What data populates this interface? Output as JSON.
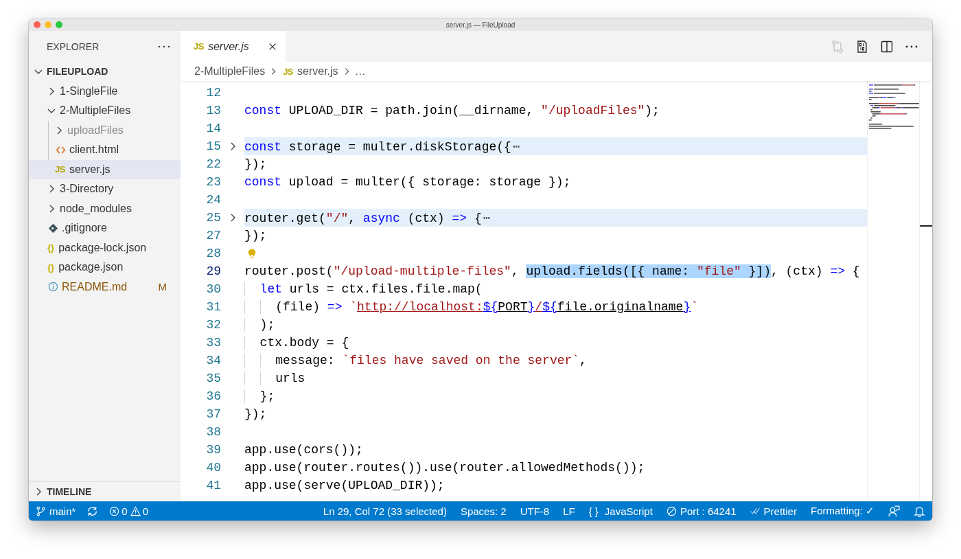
{
  "window": {
    "title": "server.js — FileUpload"
  },
  "sidebar": {
    "title": "EXPLORER",
    "root": {
      "label": "FILEUPLOAD",
      "kind": "folder",
      "expanded": true,
      "children": [
        {
          "label": "1-SingleFile",
          "kind": "folder",
          "expanded": false,
          "selected": false
        },
        {
          "label": "2-MultipleFiles",
          "kind": "folder",
          "expanded": true,
          "selected": false,
          "children": [
            {
              "label": "uploadFiles",
              "kind": "folder",
              "expanded": false,
              "selected": false,
              "dimmed": true
            },
            {
              "label": "client.html",
              "kind": "html",
              "selected": false
            },
            {
              "label": "server.js",
              "kind": "js",
              "icon": "JS",
              "selected": true
            }
          ]
        },
        {
          "label": "3-Directory",
          "kind": "folder",
          "expanded": false,
          "selected": false
        },
        {
          "label": "node_modules",
          "kind": "folder",
          "expanded": false,
          "selected": false
        },
        {
          "label": ".gitignore",
          "kind": "git",
          "selected": false
        },
        {
          "label": "package-lock.json",
          "kind": "json",
          "icon": "{}",
          "selected": false
        },
        {
          "label": "package.json",
          "kind": "json",
          "icon": "{}",
          "selected": false
        },
        {
          "label": "README.md",
          "kind": "info",
          "selected": false,
          "modified": true,
          "badge": "M"
        }
      ]
    },
    "timeline": {
      "label": "TIMELINE",
      "expanded": false
    }
  },
  "tabs": [
    {
      "label": "server.js",
      "icon": "JS",
      "selected": true,
      "preview": true
    }
  ],
  "breadcrumb": [
    {
      "label": "2-MultipleFiles"
    },
    {
      "label": "server.js",
      "icon": "JS"
    },
    {
      "label": "…"
    }
  ],
  "editor": {
    "lines": [
      {
        "num": "12"
      },
      {
        "num": "13",
        "tokens": [
          {
            "t": "const",
            "kind": "keyword"
          },
          {
            "t": " UPLOAD_DIR = path.join(__dirname, ",
            "kind": "plain"
          },
          {
            "t": "\"/uploadFiles\"",
            "kind": "string"
          },
          {
            "t": ");",
            "kind": "plain"
          }
        ]
      },
      {
        "num": "14"
      },
      {
        "num": "15",
        "folded": true,
        "tokens": [
          {
            "t": "const",
            "kind": "keyword"
          },
          {
            "t": " storage = multer.diskStorage({",
            "kind": "plain"
          },
          {
            "t": "⋯",
            "kind": "fold"
          }
        ]
      },
      {
        "num": "22",
        "tokens": [
          {
            "t": "});",
            "kind": "plain"
          }
        ]
      },
      {
        "num": "23",
        "tokens": [
          {
            "t": "const",
            "kind": "keyword"
          },
          {
            "t": " upload = multer({ storage: storage });",
            "kind": "plain"
          }
        ]
      },
      {
        "num": "24"
      },
      {
        "num": "25",
        "folded": true,
        "tokens": [
          {
            "t": "router.get(",
            "kind": "plain"
          },
          {
            "t": "\"/\"",
            "kind": "string"
          },
          {
            "t": ", ",
            "kind": "plain"
          },
          {
            "t": "async",
            "kind": "keyword"
          },
          {
            "t": " (ctx) ",
            "kind": "plain"
          },
          {
            "t": "=>",
            "kind": "keyword"
          },
          {
            "t": " {",
            "kind": "plain"
          },
          {
            "t": "⋯",
            "kind": "fold"
          }
        ]
      },
      {
        "num": "27",
        "tokens": [
          {
            "t": "});",
            "kind": "plain"
          }
        ]
      },
      {
        "num": "28",
        "lightbulb": true
      },
      {
        "num": "29",
        "current": true,
        "tokens": [
          {
            "t": "router.post(",
            "kind": "plain"
          },
          {
            "t": "\"/upload-multiple-files\"",
            "kind": "string"
          },
          {
            "t": ", ",
            "kind": "plain"
          },
          {
            "t": "upload.fields([{ name: ",
            "kind": "plain",
            "selected": true
          },
          {
            "t": "\"file\"",
            "kind": "string",
            "selected": true
          },
          {
            "t": " }])",
            "kind": "plain",
            "selected": true
          },
          {
            "t": ", (ctx) ",
            "kind": "plain"
          },
          {
            "t": "=>",
            "kind": "keyword"
          },
          {
            "t": " {",
            "kind": "plain"
          }
        ]
      },
      {
        "num": "30",
        "tokens": [
          {
            "t": "  let",
            "kind": "keyword"
          },
          {
            "t": " urls = ctx.files.file.map(",
            "kind": "plain"
          }
        ]
      },
      {
        "num": "31",
        "tokens": [
          {
            "t": "    (file) ",
            "kind": "plain"
          },
          {
            "t": "=>",
            "kind": "keyword"
          },
          {
            "t": " `",
            "kind": "string"
          },
          {
            "t": "http://localhost:",
            "kind": "string",
            "underline": true
          },
          {
            "t": "${",
            "kind": "keyword",
            "underline": true
          },
          {
            "t": "PORT",
            "kind": "plain",
            "underline": true
          },
          {
            "t": "}",
            "kind": "keyword",
            "underline": true
          },
          {
            "t": "/",
            "kind": "string",
            "underline": true
          },
          {
            "t": "${",
            "kind": "keyword",
            "underline": true
          },
          {
            "t": "file.originalname",
            "kind": "plain",
            "underline": true
          },
          {
            "t": "}",
            "kind": "keyword",
            "underline": true
          },
          {
            "t": "`",
            "kind": "string"
          }
        ]
      },
      {
        "num": "32",
        "tokens": [
          {
            "t": "  );",
            "kind": "plain"
          }
        ]
      },
      {
        "num": "33",
        "tokens": [
          {
            "t": "  ctx.body = {",
            "kind": "plain"
          }
        ]
      },
      {
        "num": "34",
        "tokens": [
          {
            "t": "    message: ",
            "kind": "plain"
          },
          {
            "t": "`files have saved on the server`",
            "kind": "string"
          },
          {
            "t": ",",
            "kind": "plain"
          }
        ]
      },
      {
        "num": "35",
        "tokens": [
          {
            "t": "    urls",
            "kind": "plain"
          }
        ]
      },
      {
        "num": "36",
        "tokens": [
          {
            "t": "  };",
            "kind": "plain"
          }
        ]
      },
      {
        "num": "37",
        "tokens": [
          {
            "t": "});",
            "kind": "plain"
          }
        ]
      },
      {
        "num": "38"
      },
      {
        "num": "39",
        "tokens": [
          {
            "t": "app.use(cors());",
            "kind": "plain"
          }
        ]
      },
      {
        "num": "40",
        "tokens": [
          {
            "t": "app.use(router.routes()).use(router.allowedMethods());",
            "kind": "plain"
          }
        ]
      },
      {
        "num": "41",
        "tokens": [
          {
            "t": "app.use(serve(UPLOAD_DIR));",
            "kind": "plain"
          }
        ]
      }
    ]
  },
  "status_bar": {
    "left": [
      {
        "kind": "branch",
        "text": "main*"
      },
      {
        "kind": "sync"
      },
      {
        "kind": "errors",
        "text": "0"
      },
      {
        "kind": "warnings",
        "text": "0"
      }
    ],
    "right": [
      {
        "kind": "text",
        "text": "Ln 29, Col 72 (33 selected)"
      },
      {
        "kind": "text",
        "text": "Spaces: 2"
      },
      {
        "kind": "text",
        "text": "UTF-8"
      },
      {
        "kind": "text",
        "text": "LF"
      },
      {
        "kind": "language",
        "icon": "{ }",
        "text": "JavaScript"
      },
      {
        "kind": "port",
        "text": "Port : 64241"
      },
      {
        "kind": "prettier",
        "text": "Prettier"
      },
      {
        "kind": "text",
        "text": "Formatting: ✓"
      },
      {
        "kind": "feedback"
      },
      {
        "kind": "bell"
      }
    ]
  }
}
